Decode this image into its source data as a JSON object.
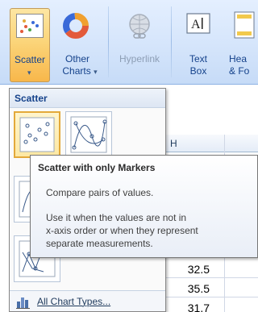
{
  "ribbon": {
    "scatter": {
      "label": "Scatter",
      "has_dropdown": true,
      "icon": "scatter-chart-icon"
    },
    "other_charts": {
      "label_line1": "Other",
      "label_line2": "Charts",
      "dropdown_arrow": "▾",
      "icon": "donut-chart-icon"
    },
    "hyperlink": {
      "label": "Hyperlink",
      "icon": "globe-link-icon",
      "enabled": false
    },
    "text_box": {
      "label_line1": "Text",
      "label_line2": "Box",
      "icon": "text-box-icon"
    },
    "header_footer": {
      "label_line1": "Hea",
      "label_line2": "& Fo",
      "icon": "page-icon"
    }
  },
  "gallery": {
    "header": "Scatter",
    "thumbnails": [
      {
        "name": "scatter-markers-only",
        "selected": true
      },
      {
        "name": "scatter-smooth-lines-markers",
        "selected": false
      },
      {
        "name": "scatter-smooth-lines",
        "selected": false
      },
      {
        "name": "scatter-straight-lines-markers",
        "selected": false
      },
      {
        "name": "scatter-straight-lines",
        "selected": false
      }
    ],
    "all_chart_types": "All Chart Types...",
    "all_chart_types_icon": "chart-types-icon"
  },
  "tooltip": {
    "title": "Scatter with only Markers",
    "line1": "Compare pairs of values.",
    "line2": "Use it when the values are not in",
    "line3": "x-axis order or when they represent",
    "line4": "separate measurements."
  },
  "sheet": {
    "column_header": "H",
    "values": [
      "32.5",
      "35.5",
      "31.7"
    ]
  },
  "colors": {
    "ribbon_bg": "#d5e5fb",
    "pressed_button": "#fbd57a",
    "selected_thumb_border": "#e3a93a",
    "tooltip_border": "#767676"
  }
}
